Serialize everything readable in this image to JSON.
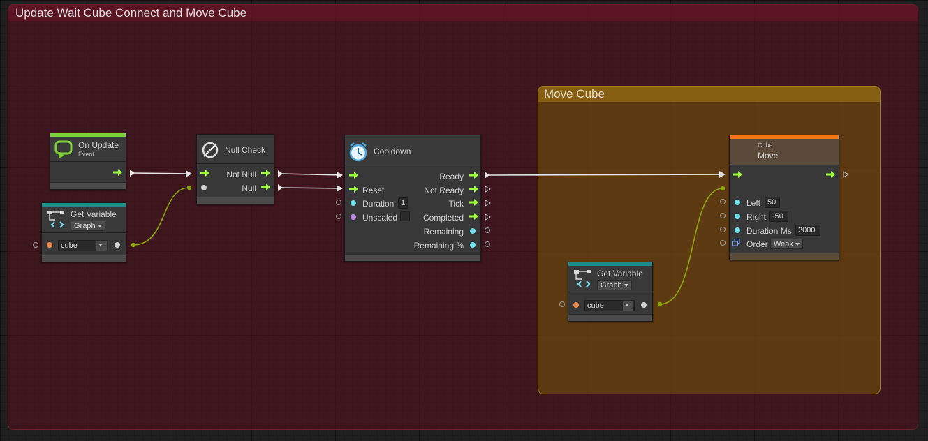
{
  "groups": {
    "main_title": "Update Wait Cube Connect and Move Cube",
    "move_title": "Move Cube"
  },
  "on_update": {
    "title": "On Update",
    "subtitle": "Event"
  },
  "get_var_1": {
    "title": "Get Variable",
    "scope": "Graph",
    "var": "cube"
  },
  "null_check": {
    "title": "Null Check",
    "not_null": "Not Null",
    "null": "Null"
  },
  "cooldown": {
    "title": "Cooldown",
    "ready": "Ready",
    "reset": "Reset",
    "not_ready": "Not Ready",
    "duration": "Duration",
    "duration_value": "1",
    "tick": "Tick",
    "unscaled": "Unscaled",
    "completed": "Completed",
    "remaining": "Remaining",
    "remaining_pct": "Remaining %"
  },
  "cube_move": {
    "category": "Cube",
    "title": "Move",
    "left": "Left",
    "left_value": "50",
    "right": "Right",
    "right_value": "-50",
    "duration_ms": "Duration Ms",
    "duration_ms_value": "2000",
    "order": "Order",
    "order_value": "Weak"
  },
  "get_var_2": {
    "title": "Get Variable",
    "scope": "Graph",
    "var": "cube"
  },
  "colors": {
    "flow_arrow": "#9cff3a",
    "object_port": "#f08a4b",
    "float_port": "#6ee2f0",
    "bool_port": "#c08ee8",
    "event_bar": "#7fd13b",
    "variable_bar": "#1f8a8a",
    "action_bar": "#f07a1a",
    "wire_data": "#8ea800",
    "wire_flow": "#e8e8e8"
  }
}
